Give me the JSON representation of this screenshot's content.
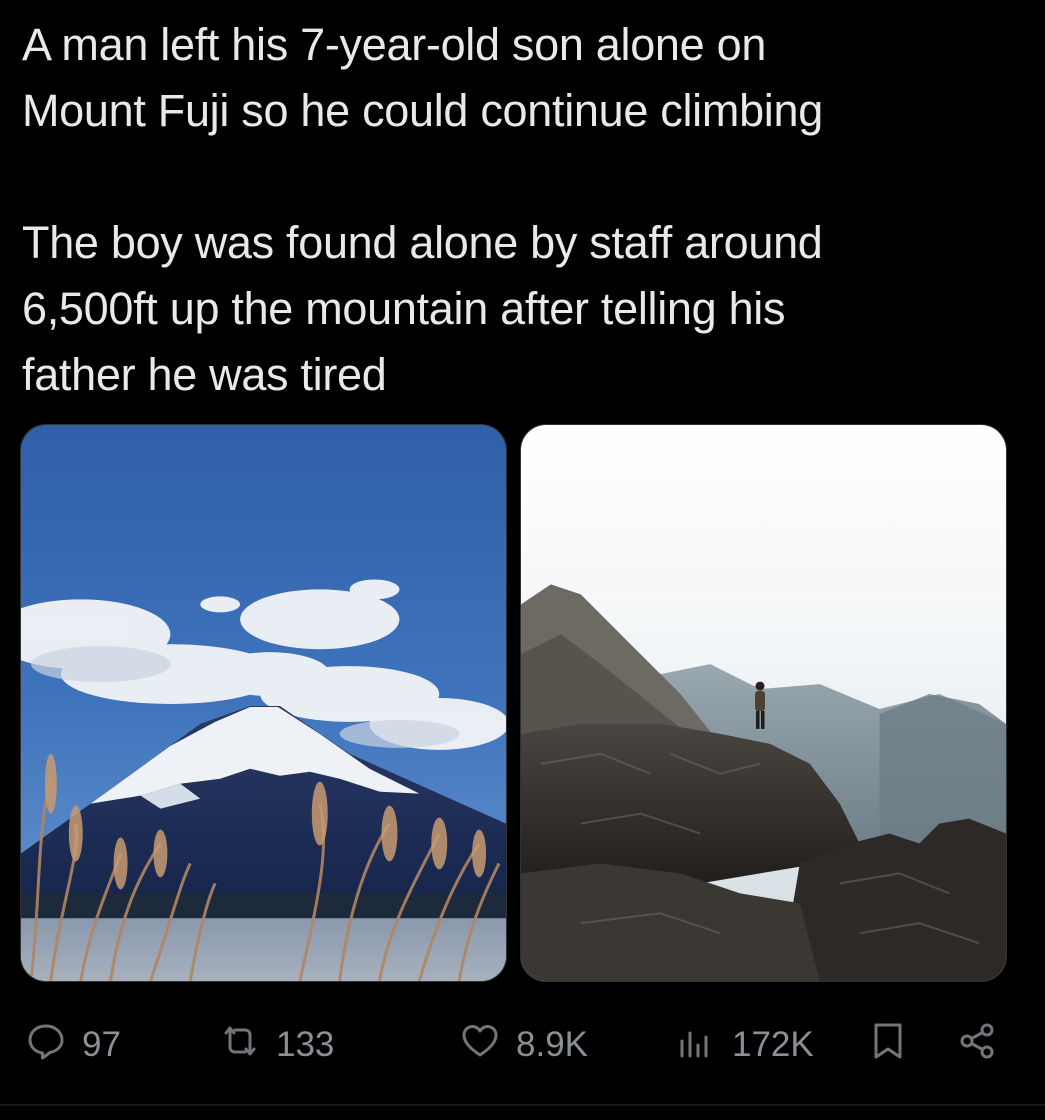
{
  "tweet": {
    "text_para1_line1": "A man left his 7-year-old son alone on",
    "text_para1_line2": "Mount Fuji so he could continue climbing",
    "text_para2_line1": "The boy was found alone by staff around",
    "text_para2_line2": "6,500ft up the mountain after telling his",
    "text_para2_line3": "father he was tired"
  },
  "media": [
    {
      "icon": "photo-mount-fuji"
    },
    {
      "icon": "photo-hiker-on-rocks"
    }
  ],
  "actions": {
    "replies": "97",
    "retweets": "133",
    "likes": "8.9K",
    "views": "172K"
  },
  "colors": {
    "background": "#000000",
    "text": "#e7e9ea",
    "muted": "#71767b"
  }
}
